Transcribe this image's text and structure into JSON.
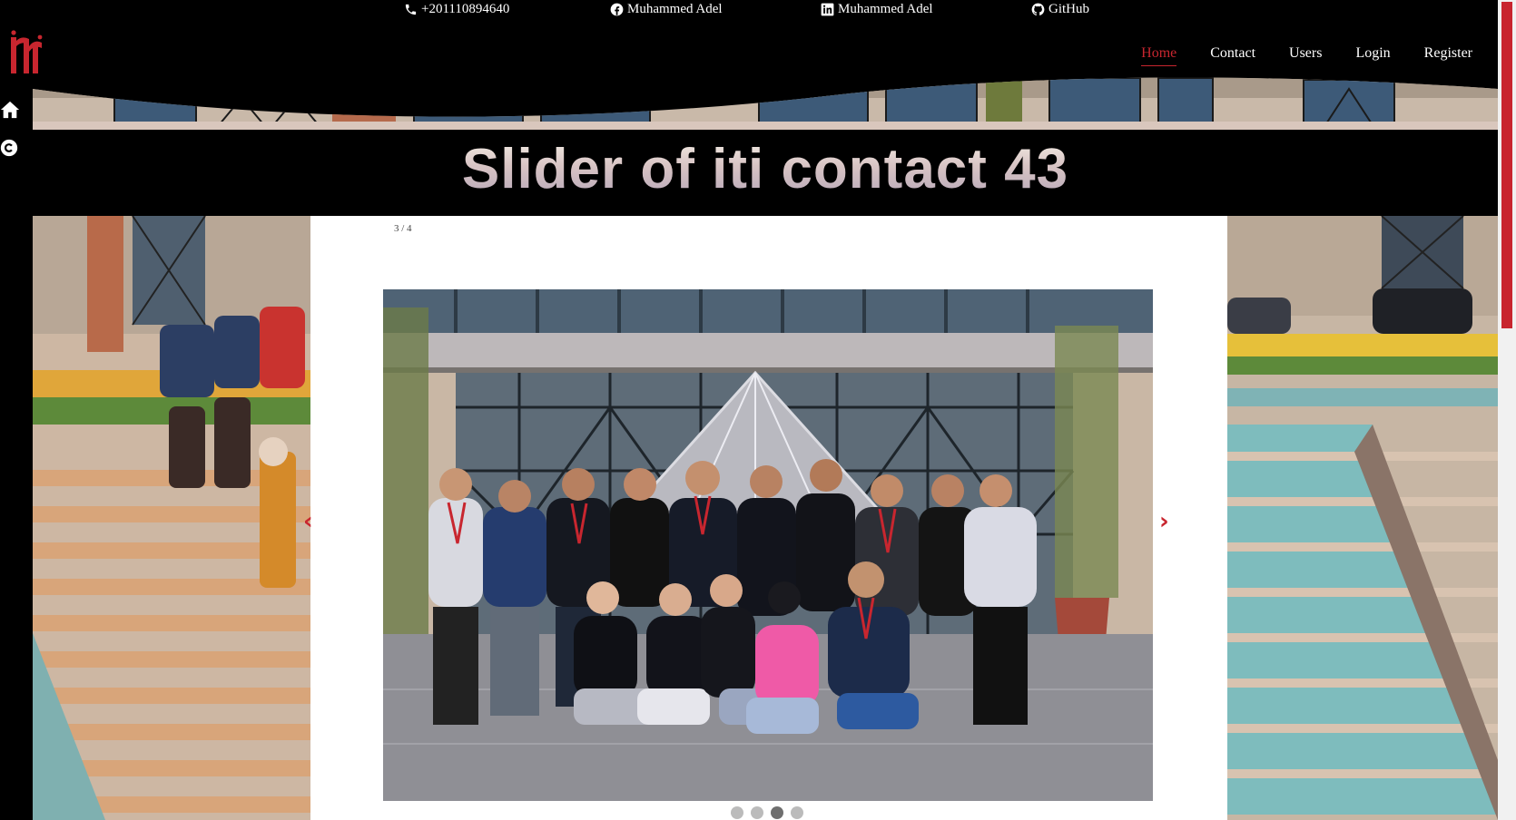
{
  "topbar": {
    "phone": "+201110894640",
    "facebook": "Muhammed Adel",
    "linkedin": "Muhammed Adel",
    "github": "GitHub"
  },
  "nav": {
    "items": [
      "Home",
      "Contact",
      "Users",
      "Login",
      "Register"
    ],
    "active": "Home"
  },
  "title": "Slider of iti contact 43",
  "slider": {
    "counter": "3 / 4",
    "prev": "‹",
    "next": "›",
    "total_slides": 4,
    "current_slide": 3
  },
  "colors": {
    "accent": "#c8262f",
    "background": "#000000",
    "text": "#ffffff"
  },
  "icons": [
    "phone-icon",
    "facebook-icon",
    "linkedin-icon",
    "github-icon",
    "home-icon",
    "copyright-icon",
    "iti-logo"
  ]
}
